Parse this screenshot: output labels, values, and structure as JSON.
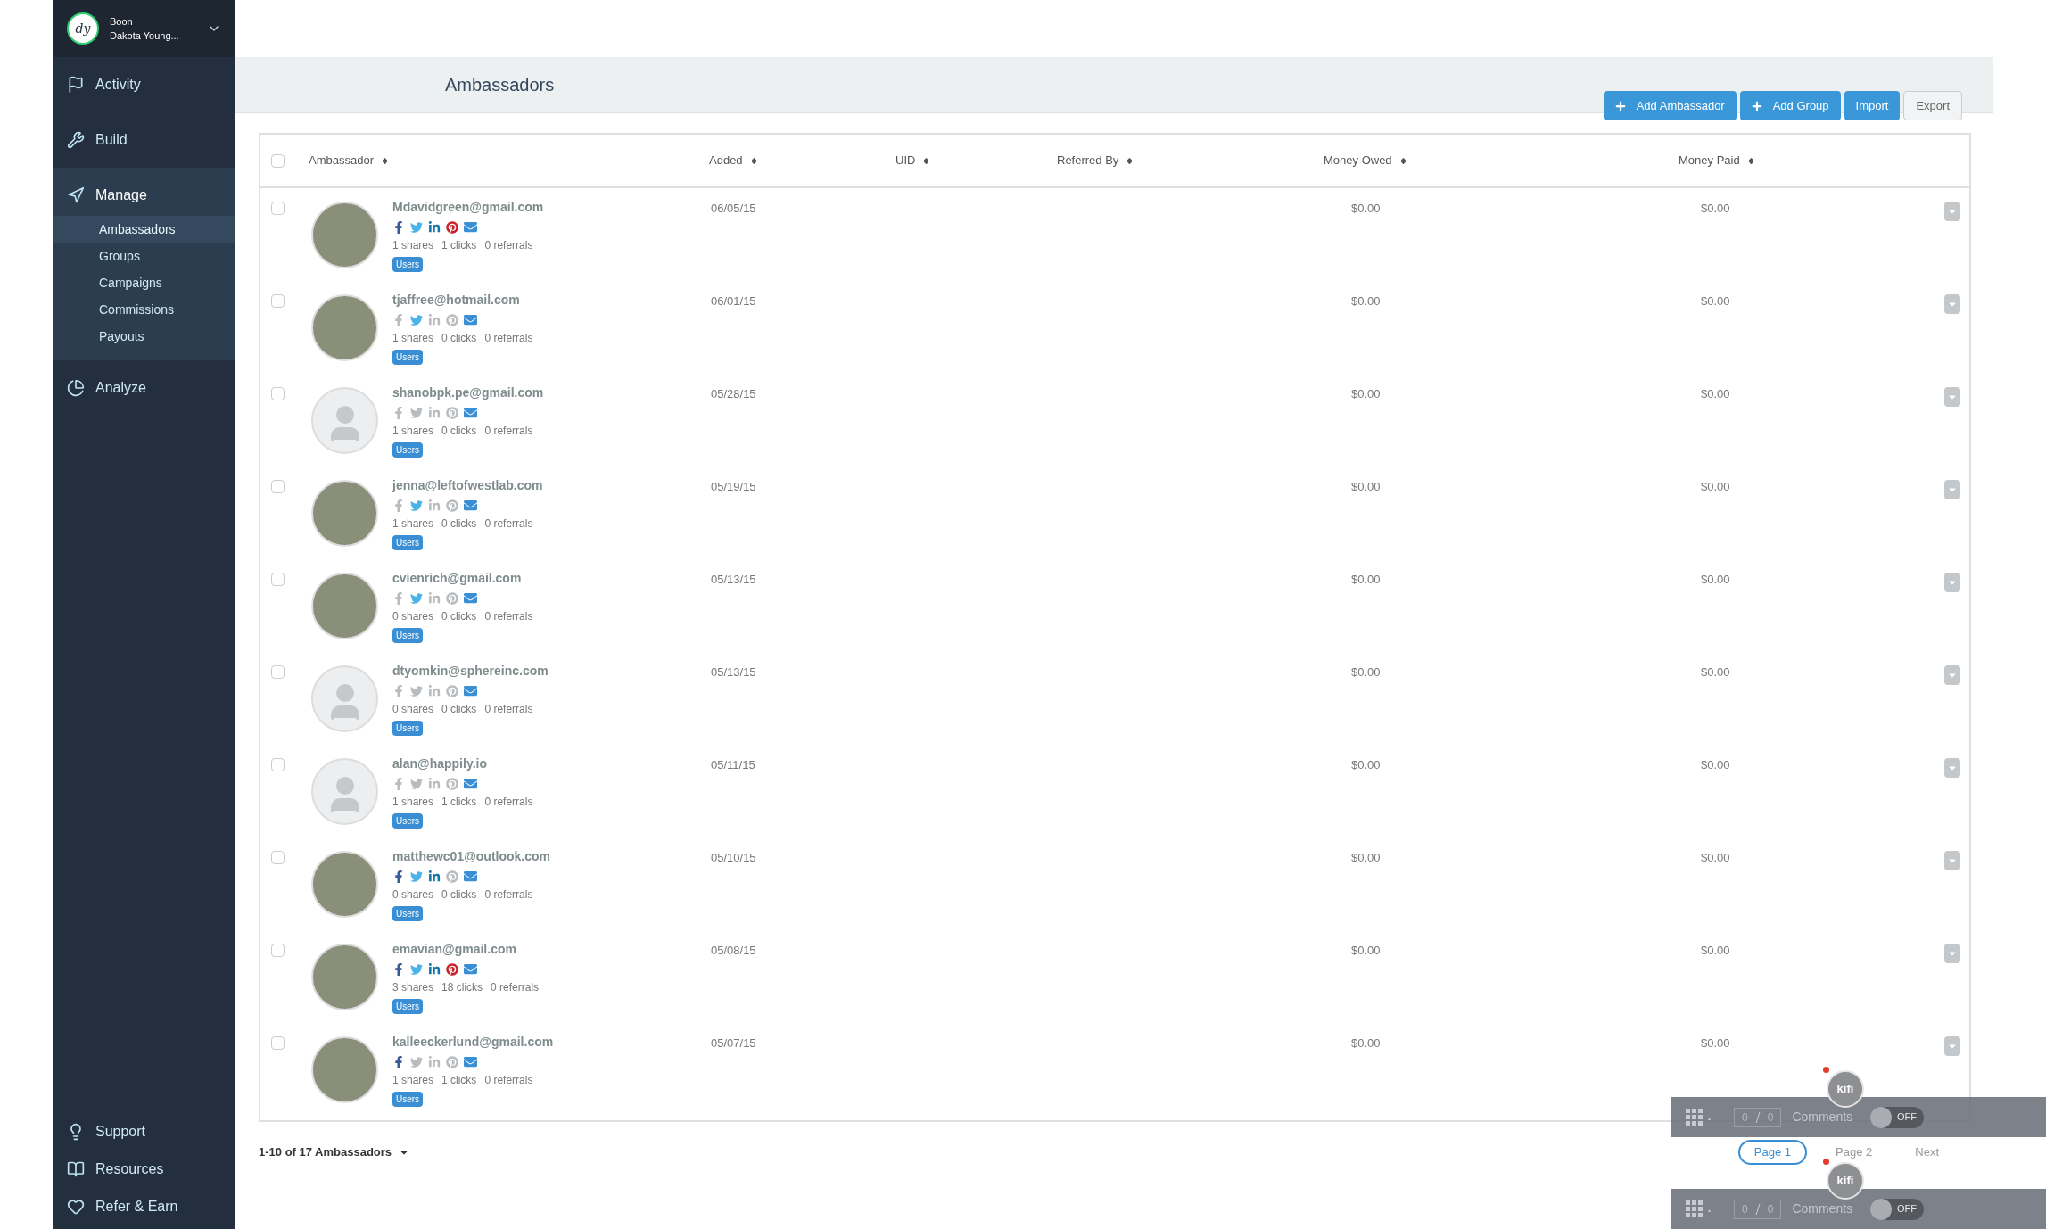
{
  "account": {
    "logo_text": "dy",
    "org": "Boon",
    "user": "Dakota Young..."
  },
  "nav": [
    {
      "label": "Activity",
      "kind": "flag",
      "selected": false
    },
    {
      "label": "Build",
      "kind": "tools",
      "selected": false
    },
    {
      "label": "Manage",
      "kind": "navigate",
      "selected": true,
      "children": [
        {
          "label": "Ambassadors",
          "selected": true
        },
        {
          "label": "Groups",
          "selected": false
        },
        {
          "label": "Campaigns",
          "selected": false
        },
        {
          "label": "Commissions",
          "selected": false
        },
        {
          "label": "Payouts",
          "selected": false
        }
      ]
    },
    {
      "label": "Analyze",
      "kind": "pie",
      "selected": false
    }
  ],
  "nav_bottom": [
    {
      "label": "Support",
      "kind": "bulb"
    },
    {
      "label": "Resources",
      "kind": "book"
    },
    {
      "label": "Refer & Earn",
      "kind": "heart"
    }
  ],
  "page": {
    "title": "Ambassadors"
  },
  "actions": [
    {
      "label": "Add Ambassador",
      "kind": "primary",
      "plus": true
    },
    {
      "label": "Add Group",
      "kind": "primary",
      "plus": true
    },
    {
      "label": "Import",
      "kind": "primary",
      "plus": false
    },
    {
      "label": "Export",
      "kind": "secondary",
      "plus": false
    }
  ],
  "table": {
    "all_checked": false,
    "columns": [
      "Ambassador",
      "Added",
      "UID",
      "Referred By",
      "Money Owed",
      "Money Paid"
    ],
    "rows": [
      {
        "checked": false,
        "kind": "photo",
        "email": "Mdavidgreen@gmail.com",
        "facebook": true,
        "twitter": true,
        "linkedin": true,
        "pinterest": true,
        "shares": "1 shares",
        "clicks": "1 clicks",
        "referrals": "0 referrals",
        "tag": "Users",
        "added": "06/05/15",
        "money_owed": "$0.00",
        "money_paid": "$0.00"
      },
      {
        "checked": false,
        "kind": "photo",
        "email": "tjaffree@hotmail.com",
        "facebook": false,
        "twitter": true,
        "linkedin": false,
        "pinterest": false,
        "shares": "1 shares",
        "clicks": "0 clicks",
        "referrals": "0 referrals",
        "tag": "Users",
        "added": "06/01/15",
        "money_owed": "$0.00",
        "money_paid": "$0.00"
      },
      {
        "checked": false,
        "kind": "default",
        "email": "shanobpk.pe@gmail.com",
        "facebook": false,
        "twitter": false,
        "linkedin": false,
        "pinterest": false,
        "shares": "1 shares",
        "clicks": "0 clicks",
        "referrals": "0 referrals",
        "tag": "Users",
        "added": "05/28/15",
        "money_owed": "$0.00",
        "money_paid": "$0.00"
      },
      {
        "checked": false,
        "kind": "photo",
        "email": "jenna@leftofwestlab.com",
        "facebook": false,
        "twitter": true,
        "linkedin": false,
        "pinterest": false,
        "shares": "1 shares",
        "clicks": "0 clicks",
        "referrals": "0 referrals",
        "tag": "Users",
        "added": "05/19/15",
        "money_owed": "$0.00",
        "money_paid": "$0.00"
      },
      {
        "checked": false,
        "kind": "photo",
        "email": "cvienrich@gmail.com",
        "facebook": false,
        "twitter": true,
        "linkedin": false,
        "pinterest": false,
        "shares": "0 shares",
        "clicks": "0 clicks",
        "referrals": "0 referrals",
        "tag": "Users",
        "added": "05/13/15",
        "money_owed": "$0.00",
        "money_paid": "$0.00"
      },
      {
        "checked": false,
        "kind": "default",
        "email": "dtyomkin@sphereinc.com",
        "facebook": false,
        "twitter": false,
        "linkedin": false,
        "pinterest": false,
        "shares": "0 shares",
        "clicks": "0 clicks",
        "referrals": "0 referrals",
        "tag": "Users",
        "added": "05/13/15",
        "money_owed": "$0.00",
        "money_paid": "$0.00"
      },
      {
        "checked": false,
        "kind": "default",
        "email": "alan@happily.io",
        "facebook": false,
        "twitter": false,
        "linkedin": false,
        "pinterest": false,
        "shares": "1 shares",
        "clicks": "1 clicks",
        "referrals": "0 referrals",
        "tag": "Users",
        "added": "05/11/15",
        "money_owed": "$0.00",
        "money_paid": "$0.00"
      },
      {
        "checked": false,
        "kind": "photo",
        "email": "matthewc01@outlook.com",
        "facebook": true,
        "twitter": true,
        "linkedin": true,
        "pinterest": false,
        "shares": "0 shares",
        "clicks": "0 clicks",
        "referrals": "0 referrals",
        "tag": "Users",
        "added": "05/10/15",
        "money_owed": "$0.00",
        "money_paid": "$0.00"
      },
      {
        "checked": false,
        "kind": "photo",
        "email": "emavian@gmail.com",
        "facebook": true,
        "twitter": true,
        "linkedin": true,
        "pinterest": true,
        "shares": "3 shares",
        "clicks": "18 clicks",
        "referrals": "0 referrals",
        "tag": "Users",
        "added": "05/08/15",
        "money_owed": "$0.00",
        "money_paid": "$0.00"
      },
      {
        "checked": false,
        "kind": "photo",
        "email": "kalleeckerlund@gmail.com",
        "facebook": true,
        "twitter": false,
        "linkedin": false,
        "pinterest": false,
        "shares": "1 shares",
        "clicks": "1 clicks",
        "referrals": "0 referrals",
        "tag": "Users",
        "added": "05/07/15",
        "money_owed": "$0.00",
        "money_paid": "$0.00"
      }
    ]
  },
  "footer": {
    "summary": "1-10 of 17 Ambassadors",
    "pages": [
      {
        "label": "Page 1",
        "selected": true
      },
      {
        "label": "Page 2",
        "selected": false
      },
      {
        "label": "Next",
        "selected": false
      }
    ]
  },
  "kifi_bars": [
    {
      "badge": "kifi",
      "count_a": "0",
      "count_b": "0",
      "label": "Comments",
      "toggle": "OFF",
      "on": false
    },
    {
      "badge": "kifi",
      "count_a": "0",
      "count_b": "0",
      "label": "Comments",
      "toggle": "OFF",
      "on": false
    }
  ]
}
